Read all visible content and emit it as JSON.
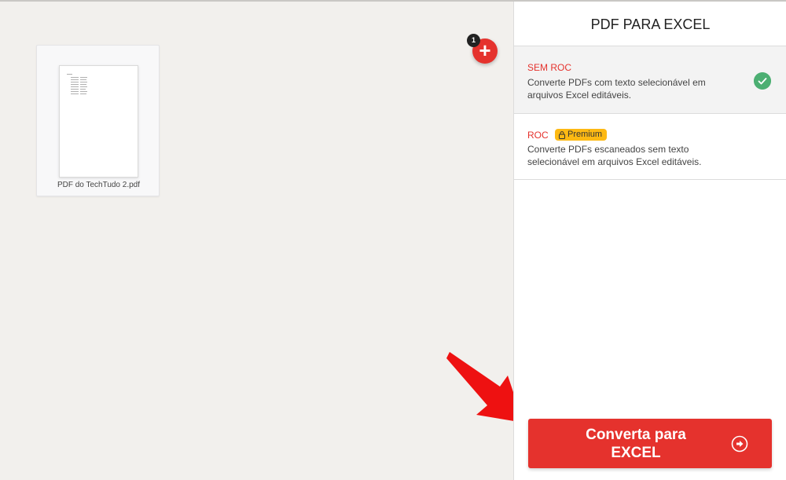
{
  "file": {
    "name": "PDF do TechTudo 2.pdf"
  },
  "add_button": {
    "count": "1",
    "symbol": "+"
  },
  "sidebar": {
    "title": "PDF PARA EXCEL",
    "options": [
      {
        "title": "SEM ROC",
        "description_line1": "Converte PDFs com texto selecionável em",
        "description_line2": "arquivos Excel editáveis.",
        "selected": true
      },
      {
        "title": "ROC",
        "badge": "Premium",
        "description_line1": "Converte PDFs escaneados sem texto",
        "description_line2": "selecionável em arquivos Excel editáveis.",
        "selected": false
      }
    ],
    "convert_button": {
      "label_line1": "Converta para",
      "label_line2": "EXCEL"
    }
  },
  "colors": {
    "accent": "#e5322d",
    "check": "#4caf72",
    "premium": "#fdb913"
  },
  "icons": {
    "add": "plus-icon",
    "selected": "check-icon",
    "premium": "lock-icon",
    "convert": "arrow-right-circle-icon",
    "pointer": "red-arrow-icon"
  }
}
